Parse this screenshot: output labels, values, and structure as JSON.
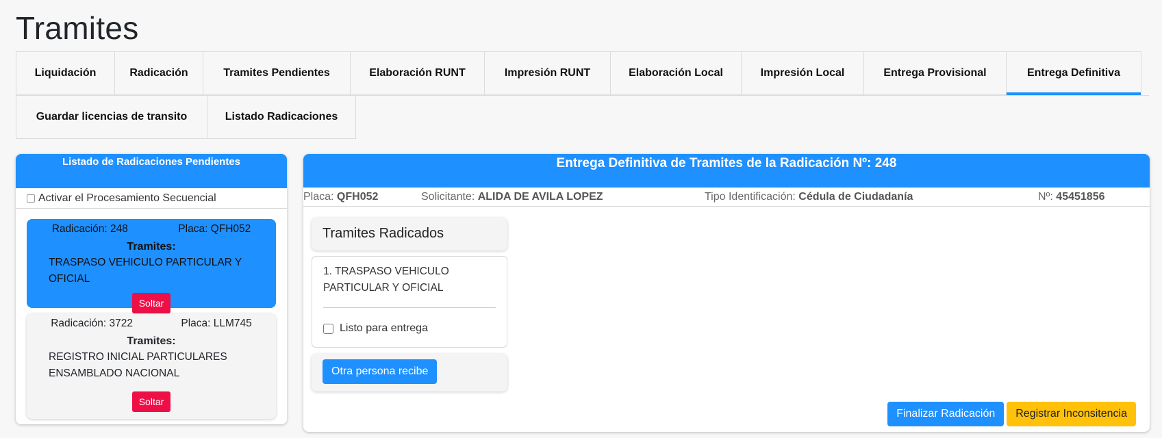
{
  "page_title": "Tramites",
  "tabs_row1": [
    {
      "label": "Liquidación",
      "active": false
    },
    {
      "label": "Radicación",
      "active": false
    },
    {
      "label": "Tramites Pendientes",
      "active": false
    },
    {
      "label": "Elaboración RUNT",
      "active": false
    },
    {
      "label": "Impresión RUNT",
      "active": false
    },
    {
      "label": "Elaboración Local",
      "active": false
    },
    {
      "label": "Impresión Local",
      "active": false
    },
    {
      "label": "Entrega Provisional",
      "active": false
    },
    {
      "label": "Entrega Definitiva",
      "active": true
    }
  ],
  "tabs_row2": [
    {
      "label": "Guardar licencias de transito"
    },
    {
      "label": "Listado Radicaciones"
    }
  ],
  "left_panel": {
    "header": "Listado de Radicaciones Pendientes",
    "sequential_label": "Activar el Procesamiento Secuencial",
    "cards": [
      {
        "radicacion": "Radicación: 248",
        "placa": "Placa: QFH052",
        "tramites_label": "Tramites:",
        "tramites_text": "TRASPASO VEHICULO PARTICULAR Y OFICIAL",
        "soltar_label": "Soltar",
        "selected": true
      },
      {
        "radicacion": "Radicación: 3722",
        "placa": "Placa: LLM745",
        "tramites_label": "Tramites:",
        "tramites_text": "REGISTRO INICIAL PARTICULARES ENSAMBLADO NACIONAL",
        "soltar_label": "Soltar",
        "selected": false
      }
    ]
  },
  "right_panel": {
    "header": "Entrega Definitiva de Tramites de la Radicación Nº: 248",
    "info": {
      "placa_label": "Placa:",
      "placa_value": "QFH052",
      "solicitante_label": "Solicitante:",
      "solicitante_value": "ALIDA DE AVILA LOPEZ",
      "tipo_label": "Tipo Identificación:",
      "tipo_value": "Cédula de Ciudadanía",
      "numero_label": "Nº:",
      "numero_value": "45451856"
    },
    "tramites_title": "Tramites Radicados",
    "tramite_item": "1. TRASPASO VEHICULO PARTICULAR Y OFICIAL",
    "listo_label": "Listo para entrega",
    "otra_persona_label": "Otra persona recibe",
    "finalizar_label": "Finalizar Radicación",
    "inconsistencia_label": "Registrar Inconsitencia"
  },
  "colors": {
    "primary": "#1e90ff",
    "danger": "#ef0f47",
    "warning": "#ffc10a"
  }
}
